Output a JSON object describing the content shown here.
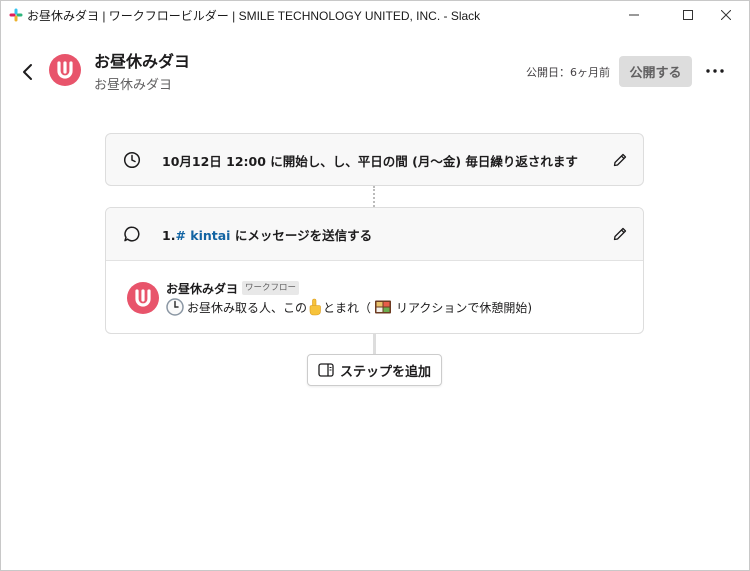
{
  "window": {
    "title": "お昼休みダヨ | ワークフロービルダー | SMILE TECHNOLOGY UNITED, INC. - Slack"
  },
  "header": {
    "title": "お昼休みダヨ",
    "subtitle": "お昼休みダヨ",
    "published": "公開日：6ヶ月前",
    "publish_label": "公開する"
  },
  "trigger": {
    "text": "10月12日 12:00 に開始し、し、平日の間 (月〜金) 毎日繰り返されます"
  },
  "step": {
    "number": "1.",
    "channel": "# kintai",
    "action": " にメッセージを送信する",
    "sender": "お昼休みダヨ",
    "badge": "ワークフロー",
    "message_part1": "お昼休み取る人、この",
    "message_part2": "とまれ（",
    "message_part3": "リアクションで休憩開始)"
  },
  "add_step_label": "ステップを追加",
  "colors": {
    "brand": "#e8546b",
    "link": "#1264a3",
    "disabled_bg": "#dddddd"
  }
}
